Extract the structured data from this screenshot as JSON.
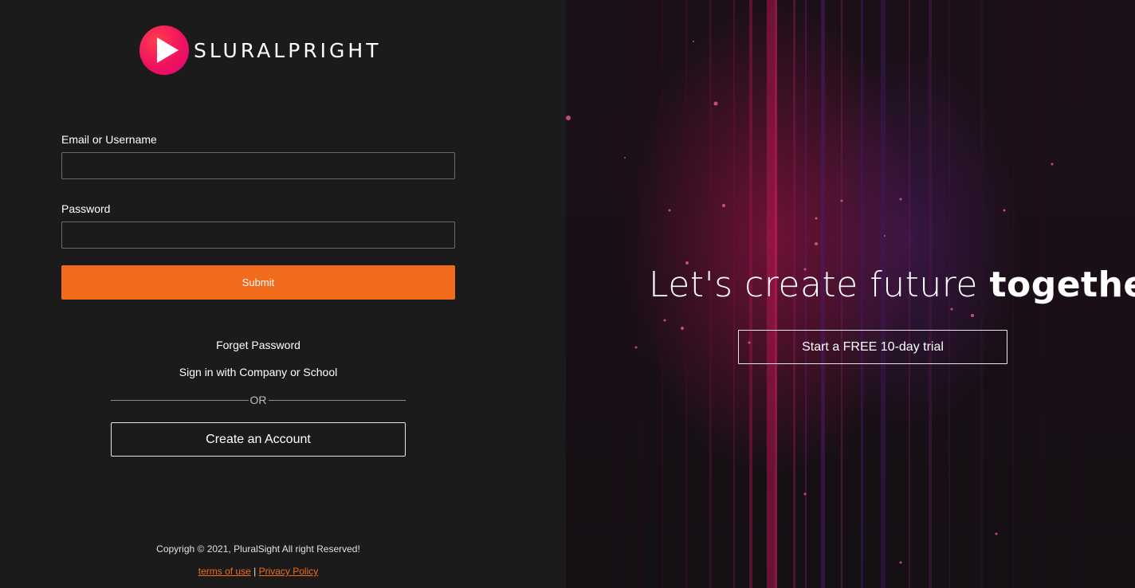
{
  "brand": {
    "logo_icon": "play-icon",
    "name": "SLURALPRIGHT",
    "accent_color": "#f26b1d",
    "logo_color": "#f0125e"
  },
  "login": {
    "email_label": "Email or Username",
    "email_value": "",
    "password_label": "Password",
    "password_value": "",
    "submit_label": "Submit",
    "forget_password": "Forget Password",
    "company_signin": "Sign in with Company or School",
    "or_text": "OR",
    "create_account": "Create an Account"
  },
  "footer": {
    "copyright": "Copyrigh © 2021, PluralSight All right Reserved!",
    "terms": "terms of use",
    "separator": "|",
    "privacy": "Privacy Policy"
  },
  "hero": {
    "tagline_light": "Let's create future",
    "tagline_bold": "together",
    "trial_button": "Start a FREE 10-day trial"
  }
}
